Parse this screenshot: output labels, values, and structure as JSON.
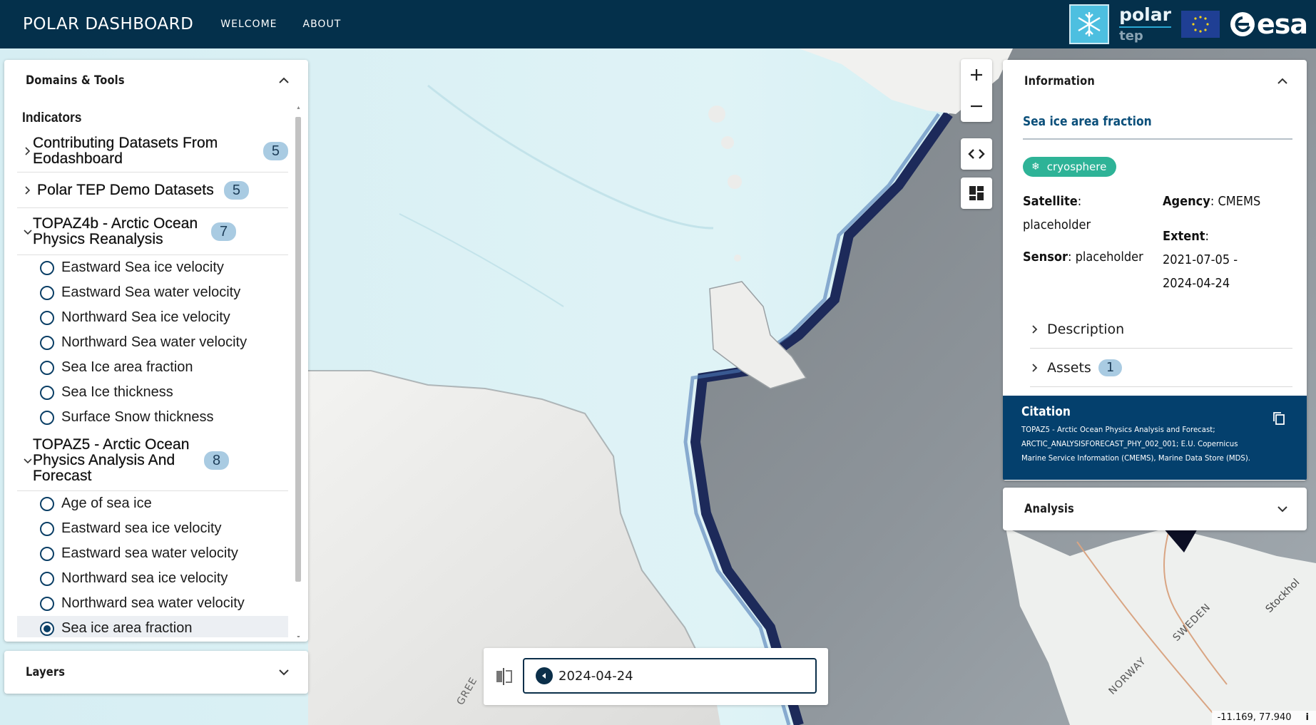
{
  "header": {
    "brand": "POLAR DASHBOARD",
    "nav": [
      "WELCOME",
      "ABOUT"
    ],
    "logos": {
      "polar_top": "polar",
      "polar_bottom": "tep",
      "agency": "esa"
    }
  },
  "domains_panel": {
    "title": "Domains & Tools",
    "section_label": "Indicators",
    "groups": [
      {
        "title": "Contributing Datasets From Eodashboard",
        "count": "5",
        "expanded": false
      },
      {
        "title": "Polar TEP Demo Datasets",
        "count": "5",
        "expanded": false
      },
      {
        "title": "TOPAZ4b - Arctic Ocean Physics Reanalysis",
        "count": "7",
        "expanded": true,
        "items": [
          "Eastward Sea ice velocity",
          "Eastward Sea water velocity",
          "Northward Sea ice velocity",
          "Northward Sea water velocity",
          "Sea Ice area fraction",
          "Sea Ice thickness",
          "Surface Snow thickness"
        ]
      },
      {
        "title": "TOPAZ5 - Arctic Ocean Physics Analysis And Forecast",
        "count": "8",
        "expanded": true,
        "items": [
          "Age of sea ice",
          "Eastward sea ice velocity",
          "Eastward sea water velocity",
          "Northward sea ice velocity",
          "Northward sea water velocity",
          "Sea ice area fraction"
        ],
        "selected_item": "Sea ice area fraction"
      }
    ]
  },
  "layers_panel": {
    "title": "Layers"
  },
  "info_panel": {
    "title": "Information",
    "dataset_title": "Sea ice area fraction",
    "tag": "cryosphere",
    "satellite_label": "Satellite",
    "satellite_value": "placeholder",
    "sensor_label": "Sensor",
    "sensor_value": "placeholder",
    "agency_label": "Agency",
    "agency_value": "CMEMS",
    "extent_label": "Extent",
    "extent_value_1": "2021-07-05 -",
    "extent_value_2": "2024-04-24",
    "description_label": "Description",
    "assets_label": "Assets",
    "assets_count": "1"
  },
  "citation": {
    "title": "Citation",
    "text": "TOPAZ5 - Arctic Ocean Physics Analysis and Forecast; ARCTIC_ANALYSISFORECAST_PHY_002_001; E.U. Copernicus Marine Service Information (CMEMS), Marine Data Store (MDS)."
  },
  "analysis_panel": {
    "title": "Analysis"
  },
  "time_control": {
    "date": "2024-04-24"
  },
  "map": {
    "labels": [
      "NORWAY",
      "SWEDEN",
      "Stockhol",
      "GREE"
    ],
    "coordinates": "-11.169, 77.940",
    "info_glyph": "i"
  },
  "colors": {
    "header_bg": "#04304b",
    "citation_bg": "#04406d",
    "badge_bg": "#a9cbe2",
    "tag_bg": "#2eb397"
  }
}
